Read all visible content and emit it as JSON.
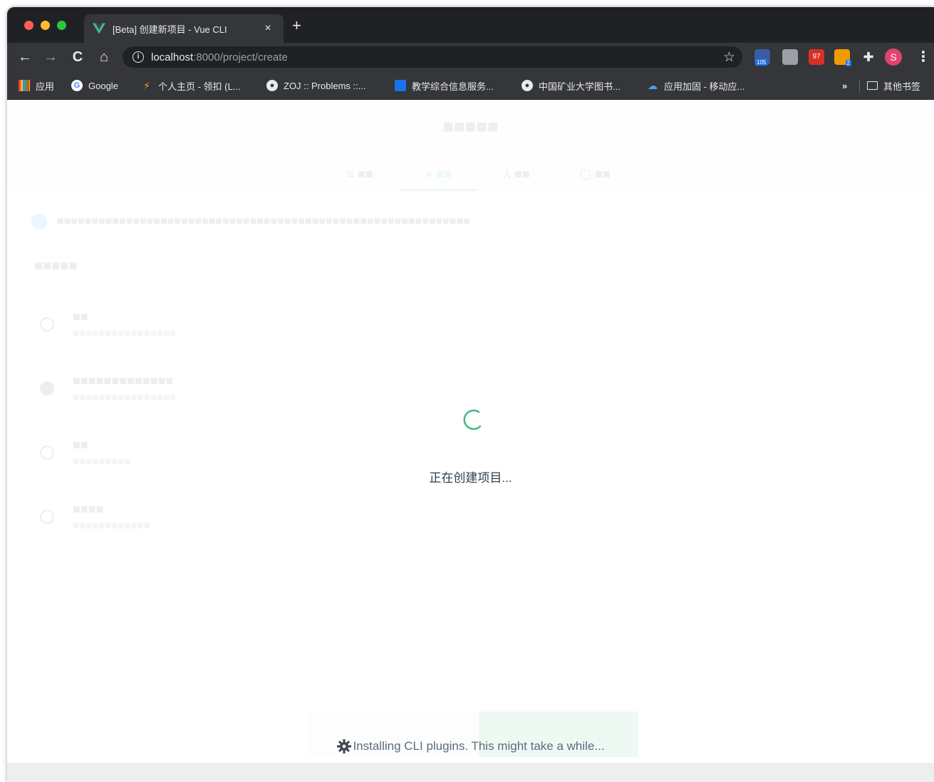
{
  "browser": {
    "tab": {
      "title": "[Beta] 创建新项目 - Vue CLI",
      "close_label": "×",
      "favicon": "vue-logo-icon"
    },
    "new_tab_label": "+",
    "nav": {
      "back": "←",
      "forward": "→",
      "reload": "C",
      "home": "⌂"
    },
    "address": {
      "info_glyph": "i",
      "host": "localhost",
      "path": ":8000/project/create"
    },
    "star_glyph": "☆",
    "extensions": [
      {
        "name": "extension-badge-icon",
        "badge": "105"
      },
      {
        "name": "mail-extension-icon"
      },
      {
        "name": "red-extension-icon",
        "badge": "97"
      },
      {
        "name": "rss-extension-icon",
        "badge": "2"
      },
      {
        "name": "puzzle-icon"
      }
    ],
    "profile_initial": "S",
    "menu_glyph": "⋮",
    "bookmarks": [
      {
        "label": "应用",
        "icon": "apps-grid-icon"
      },
      {
        "label": "Google",
        "icon": "google-icon"
      },
      {
        "label": "个人主页 - 领扣 (L...",
        "icon": "leetcode-icon"
      },
      {
        "label": "ZOJ :: Problems ::...",
        "icon": "globe-icon"
      },
      {
        "label": "教学综合信息服务...",
        "icon": "school-icon"
      },
      {
        "label": "中国矿业大学图书...",
        "icon": "globe-icon"
      },
      {
        "label": "应用加固 - 移动应...",
        "icon": "cloud-icon"
      }
    ],
    "more_bookmarks": "»",
    "other_bookmarks": "其他书签"
  },
  "page": {
    "loading_text": "正在创建项目...",
    "progress_text": "Installing CLI plugins. This might take a while..."
  },
  "colors": {
    "accent": "#42b983",
    "text": "#2c3e50",
    "chrome_dark": "#202124",
    "chrome_mid": "#35363a"
  }
}
